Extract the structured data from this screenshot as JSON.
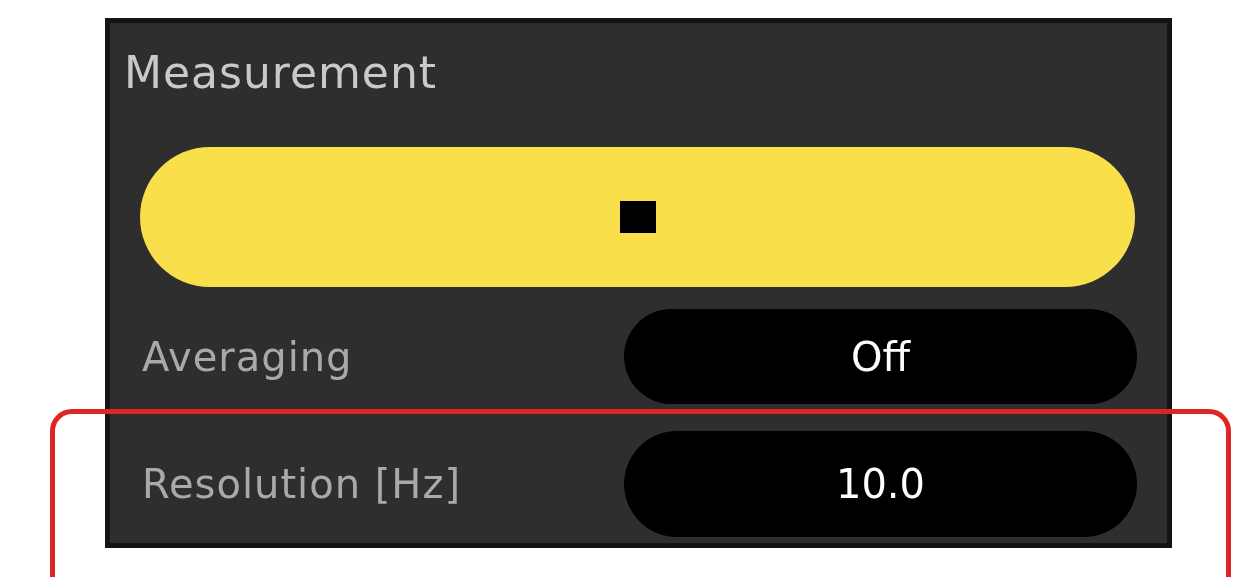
{
  "panel": {
    "title": "Measurement",
    "run_button": {
      "kind": "stop"
    },
    "rows": [
      {
        "label": "Averaging",
        "value": "Off",
        "highlighted": false
      },
      {
        "label": "Resolution [Hz]",
        "value": "10.0",
        "highlighted": true
      }
    ]
  }
}
